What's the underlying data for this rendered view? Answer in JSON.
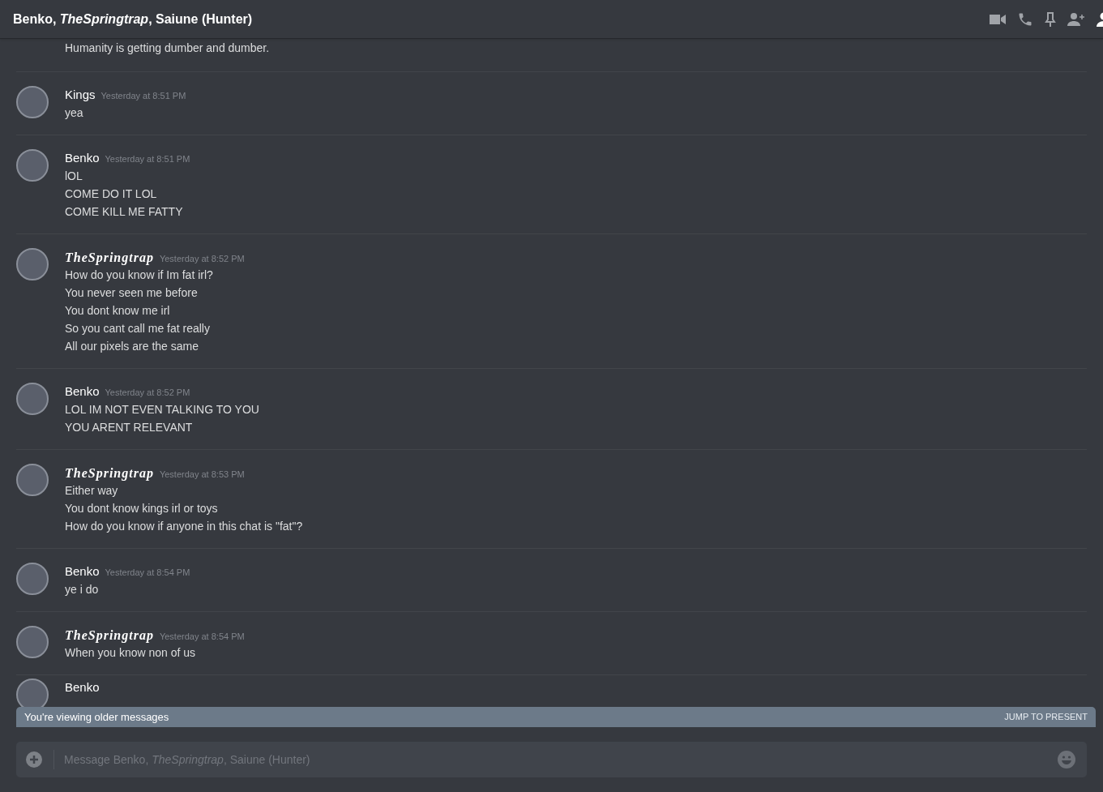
{
  "window": {
    "title": "Benko, *TheSpringtrap*, Saiune (Hunter)"
  },
  "messages": [
    {
      "kind": "continued",
      "lines": [
        "Humanity is getting dumber and dumber."
      ]
    },
    {
      "kind": "plain",
      "author": "Kings",
      "time": "Yesterday at 8:51 PM",
      "lines": [
        "yea"
      ]
    },
    {
      "kind": "plain",
      "author": "Benko",
      "time": "Yesterday at 8:51 PM",
      "lines": [
        "lOL",
        "COME DO IT LOL",
        "COME KILL ME FATTY"
      ]
    },
    {
      "kind": "script",
      "author": "TheSpringtrap",
      "time": "Yesterday at 8:52 PM",
      "lines": [
        "How do you know if Im fat irl?",
        "You never seen me before",
        "You dont know me irl",
        "So you cant call me fat really",
        "All our pixels are the same"
      ]
    },
    {
      "kind": "plain",
      "author": "Benko",
      "time": "Yesterday at 8:52 PM",
      "lines": [
        "LOL IM NOT EVEN TALKING TO YOU",
        "YOU ARENT RELEVANT"
      ]
    },
    {
      "kind": "script",
      "author": "TheSpringtrap",
      "time": "Yesterday at 8:53 PM",
      "lines": [
        "Either way",
        "You dont know kings irl or toys",
        "How do you know if anyone in this chat is \"fat\"?"
      ]
    },
    {
      "kind": "plain",
      "author": "Benko",
      "time": "Yesterday at 8:54 PM",
      "lines": [
        "ye i do"
      ]
    },
    {
      "kind": "script",
      "author": "TheSpringtrap",
      "time": "Yesterday at 8:54 PM",
      "lines": [
        "When you know non of us"
      ]
    },
    {
      "kind": "plain",
      "author": "Benko"
    }
  ],
  "banner": {
    "text": "You're viewing older messages",
    "action": "JUMP TO PRESENT"
  },
  "composer": {
    "placeholder": "Message Benko, *TheSpringtrap*, Saiune (Hunter)"
  }
}
